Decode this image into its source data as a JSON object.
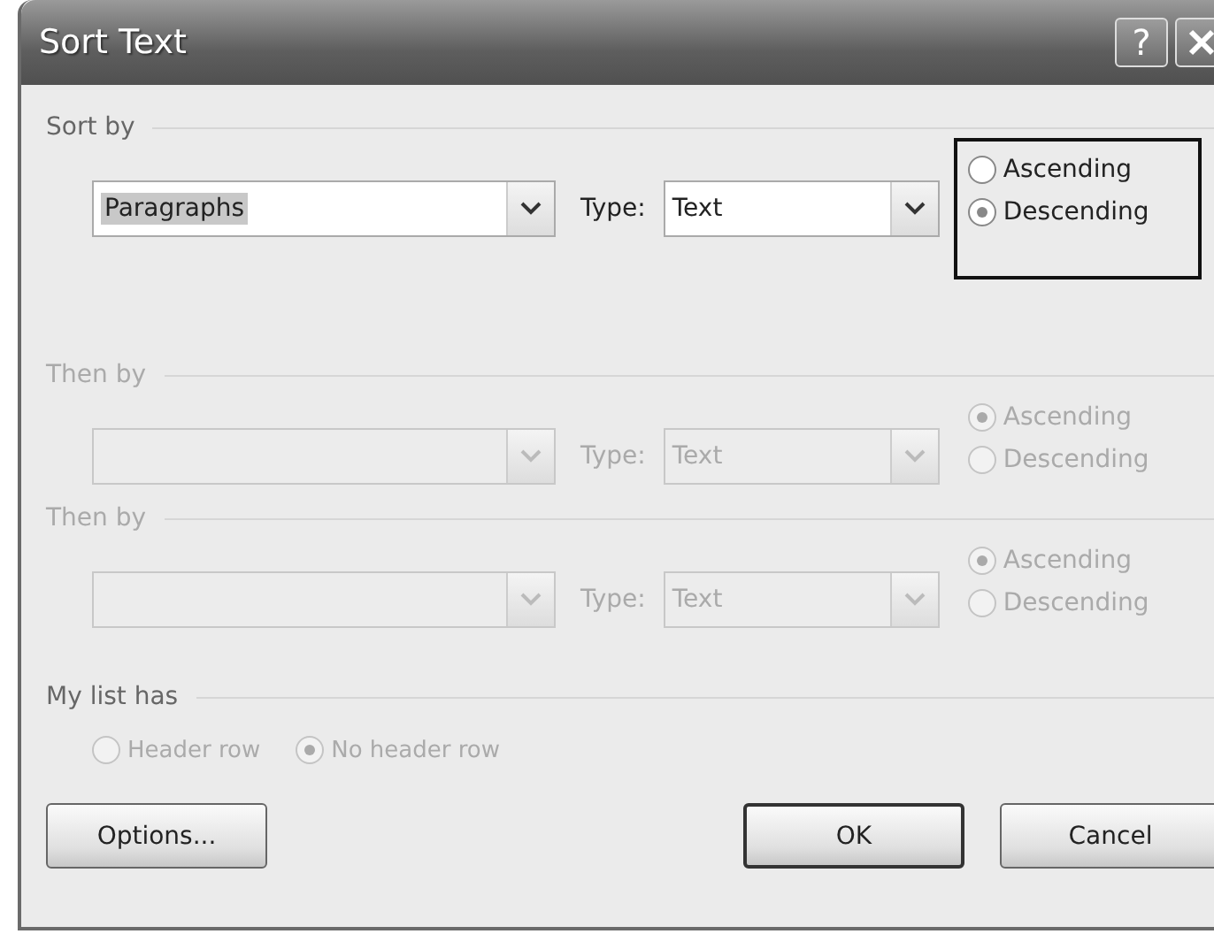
{
  "window": {
    "title": "Sort Text",
    "help_button": "?"
  },
  "sort_levels": [
    {
      "label": "Sort by",
      "disabled": false,
      "focused": true,
      "field": {
        "value": "Paragraphs",
        "highlighted": true
      },
      "type_label": "Type:",
      "type_value": "Text",
      "orders": [
        {
          "label": "Ascending",
          "selected": false
        },
        {
          "label": "Descending",
          "selected": true
        }
      ]
    },
    {
      "label": "Then by",
      "disabled": true,
      "focused": false,
      "type_label": "Type:",
      "type_value": "Text",
      "orders": [
        {
          "label": "Ascending",
          "selected": true
        },
        {
          "label": "Descending",
          "selected": false
        }
      ]
    },
    {
      "label": "Then by",
      "disabled": true,
      "focused": false,
      "type_label": "Type:",
      "type_value": "Text",
      "orders": [
        {
          "label": "Ascending",
          "selected": true
        },
        {
          "label": "Descending",
          "selected": false
        }
      ]
    }
  ],
  "list_has": {
    "label": "My list has",
    "disabled": true,
    "options": [
      {
        "label": "Header row",
        "selected": false
      },
      {
        "label": "No header row",
        "selected": true
      }
    ]
  },
  "buttons": [
    {
      "label": "Options...",
      "default": false
    },
    {
      "label": "OK",
      "default": true
    },
    {
      "label": "Cancel",
      "default": false
    }
  ]
}
